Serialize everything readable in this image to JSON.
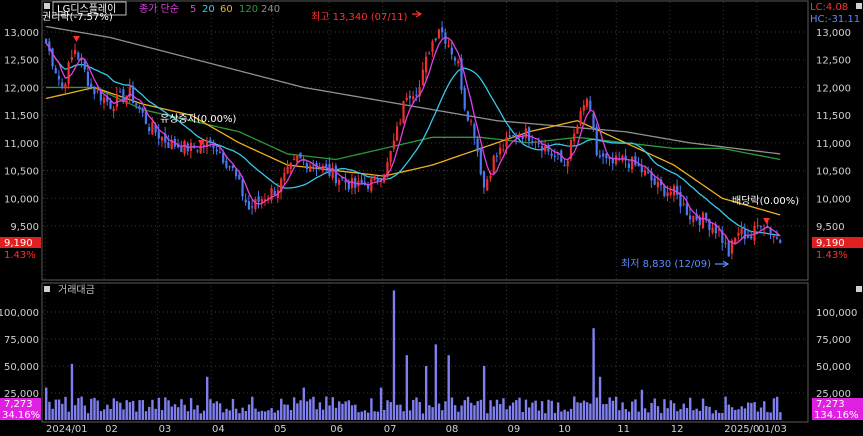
{
  "header": {
    "ticker": "LG디스플레이",
    "legend_prefix": "종가 단순",
    "ma_periods": [
      "5",
      "20",
      "60",
      "120",
      "240"
    ],
    "ma_colors": [
      "#e040e0",
      "#36c8e8",
      "#f0b020",
      "#2a9a3a",
      "#909090"
    ],
    "lc": "LC:4.08",
    "hc": "HC:-31.11"
  },
  "annotations": {
    "rights": "권리락(-7.57%)",
    "paid_increase": "유상증자(0.00%)",
    "high": "최고 13,340 (07/11)",
    "low": "최저 8,830 (12/09)",
    "dividend": "배당락(0.00%)"
  },
  "price_badges": {
    "last": "9,190",
    "change_pct": "1.43%"
  },
  "volume_panel": {
    "title": "거래대금",
    "last": "7,273",
    "left_pct": "34.16%",
    "right_pct": "134.16%"
  },
  "colors": {
    "up": "#f03030",
    "down": "#4a78f0",
    "volume": "#7f7ff0",
    "badge": "#e02020",
    "vol_badge": "#e020e0",
    "grid": "#3a3a3a"
  },
  "chart_data": [
    {
      "type": "candlestick",
      "title": "LG디스플레이",
      "ylim": [
        9190,
        13000
      ],
      "y_ticks": [
        9500,
        10000,
        10500,
        11000,
        11500,
        12000,
        12500,
        13000
      ],
      "y_tick_labels": [
        "9,500",
        "10,000",
        "10,500",
        "11,000",
        "11,500",
        "12,000",
        "12,500",
        "13,000"
      ],
      "x_tick_labels": [
        "2024/01",
        "02",
        "03",
        "04",
        "05",
        "06",
        "07",
        "08",
        "09",
        "10",
        "11",
        "12",
        "2025/0",
        "01/03"
      ],
      "close_anchors": [
        [
          0,
          12800
        ],
        [
          5,
          12000
        ],
        [
          9,
          12700
        ],
        [
          14,
          12000
        ],
        [
          20,
          11700
        ],
        [
          26,
          11900
        ],
        [
          32,
          11300
        ],
        [
          38,
          11000
        ],
        [
          45,
          10900
        ],
        [
          52,
          11000
        ],
        [
          58,
          10500
        ],
        [
          63,
          9800
        ],
        [
          67,
          10000
        ],
        [
          72,
          10200
        ],
        [
          78,
          10700
        ],
        [
          84,
          10600
        ],
        [
          90,
          10400
        ],
        [
          96,
          10200
        ],
        [
          102,
          10300
        ],
        [
          106,
          10600
        ],
        [
          109,
          11200
        ],
        [
          112,
          11900
        ],
        [
          116,
          12000
        ],
        [
          119,
          12700
        ],
        [
          122,
          13100
        ],
        [
          125,
          12800
        ],
        [
          128,
          12400
        ],
        [
          130,
          11700
        ],
        [
          133,
          11200
        ],
        [
          136,
          10200
        ],
        [
          139,
          10700
        ],
        [
          143,
          11000
        ],
        [
          147,
          11200
        ],
        [
          152,
          11100
        ],
        [
          157,
          10800
        ],
        [
          161,
          10600
        ],
        [
          165,
          11300
        ],
        [
          168,
          11800
        ],
        [
          171,
          10800
        ],
        [
          175,
          10600
        ],
        [
          180,
          10700
        ],
        [
          185,
          10500
        ],
        [
          190,
          10200
        ],
        [
          195,
          10100
        ],
        [
          200,
          9700
        ],
        [
          205,
          9600
        ],
        [
          209,
          9400
        ],
        [
          212,
          9000
        ],
        [
          215,
          9400
        ],
        [
          219,
          9300
        ],
        [
          222,
          9600
        ],
        [
          226,
          9350
        ],
        [
          228,
          9190
        ]
      ],
      "moving_averages": [
        {
          "name": "5",
          "color": "#e040e0"
        },
        {
          "name": "20",
          "color": "#36c8e8"
        },
        {
          "name": "60",
          "color": "#f0b020"
        },
        {
          "name": "120",
          "color": "#2a9a3a"
        },
        {
          "name": "240",
          "color": "#909090"
        }
      ],
      "ma_anchors": {
        "60": [
          [
            0,
            11800
          ],
          [
            15,
            12000
          ],
          [
            30,
            11700
          ],
          [
            45,
            11500
          ],
          [
            60,
            11000
          ],
          [
            75,
            10600
          ],
          [
            90,
            10500
          ],
          [
            105,
            10400
          ],
          [
            120,
            10600
          ],
          [
            135,
            10900
          ],
          [
            150,
            11200
          ],
          [
            165,
            11400
          ],
          [
            180,
            11000
          ],
          [
            195,
            10600
          ],
          [
            210,
            10000
          ],
          [
            228,
            9700
          ]
        ],
        "120": [
          [
            0,
            12000
          ],
          [
            15,
            12000
          ],
          [
            30,
            11600
          ],
          [
            45,
            11400
          ],
          [
            60,
            11200
          ],
          [
            75,
            10800
          ],
          [
            90,
            10700
          ],
          [
            105,
            10900
          ],
          [
            120,
            11100
          ],
          [
            135,
            11100
          ],
          [
            150,
            11000
          ],
          [
            165,
            11100
          ],
          [
            180,
            11000
          ],
          [
            195,
            10900
          ],
          [
            210,
            10900
          ],
          [
            228,
            10700
          ]
        ],
        "240": [
          [
            0,
            13100
          ],
          [
            20,
            12900
          ],
          [
            40,
            12600
          ],
          [
            60,
            12300
          ],
          [
            80,
            12000
          ],
          [
            100,
            11800
          ],
          [
            120,
            11600
          ],
          [
            140,
            11400
          ],
          [
            160,
            11300
          ],
          [
            180,
            11200
          ],
          [
            200,
            11000
          ],
          [
            228,
            10800
          ]
        ]
      }
    },
    {
      "type": "bar",
      "title": "거래대금",
      "ylim": [
        0,
        125000
      ],
      "y_ticks": [
        25000,
        50000,
        75000,
        100000
      ],
      "y_tick_labels": [
        "25,000",
        "50,000",
        "75,000",
        "100,000"
      ],
      "spikes": [
        [
          0,
          30000
        ],
        [
          8,
          52000
        ],
        [
          50,
          40000
        ],
        [
          80,
          30000
        ],
        [
          104,
          30000
        ],
        [
          108,
          120000
        ],
        [
          112,
          60000
        ],
        [
          118,
          50000
        ],
        [
          121,
          70000
        ],
        [
          125,
          60000
        ],
        [
          136,
          50000
        ],
        [
          170,
          85000
        ],
        [
          172,
          40000
        ],
        [
          185,
          28000
        ]
      ],
      "last": 7273
    }
  ]
}
